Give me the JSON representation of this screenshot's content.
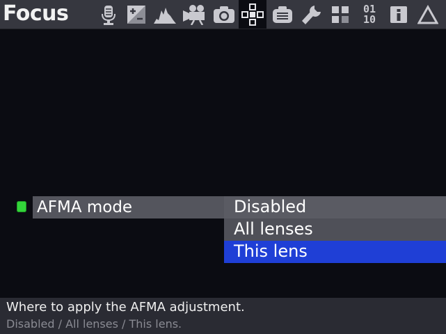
{
  "header": {
    "title": "Focus",
    "tabs": [
      {
        "icon": "microphone-icon"
      },
      {
        "icon": "exposure-compensation-icon"
      },
      {
        "icon": "histogram-icon"
      },
      {
        "icon": "movie-camera-icon"
      },
      {
        "icon": "camera-icon"
      },
      {
        "icon": "focus-points-icon",
        "active": true
      },
      {
        "icon": "display-settings-icon"
      },
      {
        "icon": "wrench-icon"
      },
      {
        "icon": "custom-grid-icon"
      },
      {
        "icon": "binary-icon",
        "text_top": "01",
        "text_bottom": "10"
      },
      {
        "icon": "info-icon"
      },
      {
        "icon": "delta-icon"
      }
    ]
  },
  "setting": {
    "label": "AFMA mode",
    "indicator_color": "#33d43a",
    "options": [
      "Disabled",
      "All lenses",
      "This lens"
    ],
    "selected": "This lens",
    "selected_color": "#1f3fd6"
  },
  "help": {
    "line1": "Where to apply the AFMA adjustment.",
    "line2": "Disabled / All lenses / This lens."
  }
}
